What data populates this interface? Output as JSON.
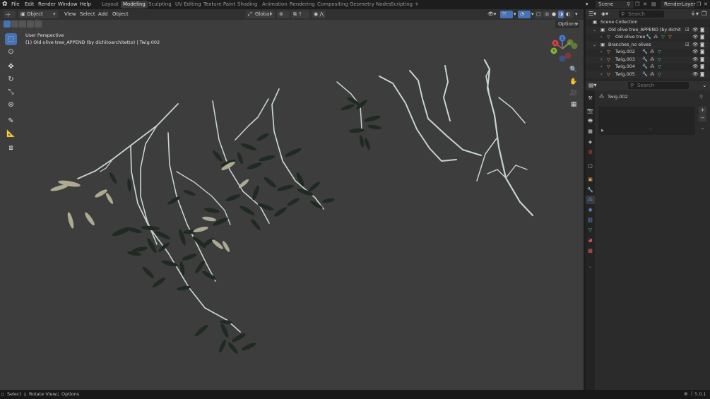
{
  "menu": {
    "file": "File",
    "edit": "Edit",
    "render": "Render",
    "window": "Window",
    "help": "Help"
  },
  "workspaces": [
    "Layout",
    "Modeling",
    "Sculpting",
    "UV Editing",
    "Texture Paint",
    "Shading",
    "Animation",
    "Rendering",
    "Compositing",
    "Geometry Nodes",
    "Scripting"
  ],
  "active_workspace": "Modeling",
  "add_workspace": "+",
  "scene": {
    "name": "Scene"
  },
  "view_layer": {
    "name": "RenderLayer"
  },
  "viewport_header": {
    "mode": "Object Mode",
    "view": "View",
    "select": "Select",
    "add": "Add",
    "object": "Object",
    "transform_orientation": "Global"
  },
  "viewport": {
    "perspective_label": "User Perspective",
    "object_label": "(1) Old olive tree_APPEND (by dichitoarchitetto) | Twig.002",
    "options": "Options",
    "gizmo": {
      "z": "Z",
      "y": "Y",
      "x": "X"
    }
  },
  "outliner": {
    "search_placeholder": "Search",
    "rows": [
      {
        "name": "Scene Collection"
      },
      {
        "name": "Old olive tree_APPEND (by dichit"
      },
      {
        "name": "Old olive tree"
      },
      {
        "name": "Branches_no olives"
      },
      {
        "name": "Twig.002"
      },
      {
        "name": "Twig.003"
      },
      {
        "name": "Twig.004"
      },
      {
        "name": "Twig.005"
      }
    ]
  },
  "properties": {
    "search_placeholder": "Search",
    "object_name": "Twig.002"
  },
  "status_bar": {
    "select": "Select",
    "rotate_view": "Rotate View",
    "options": "Options",
    "version": "5.0.1"
  },
  "colors": {
    "accent": "#4772b3",
    "viewport_bg": "#3d3d3d",
    "twig": "#c7d4cf",
    "leaf_dark": "#1f2a22",
    "leaf_light": "#b9b89c"
  }
}
